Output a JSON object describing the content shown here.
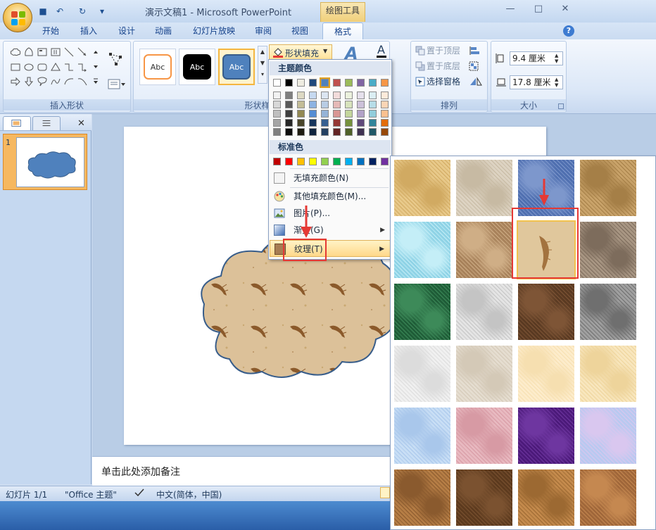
{
  "window": {
    "title": "演示文稿1 - Microsoft PowerPoint",
    "context_tab_title": "绘图工具",
    "minimize": "—",
    "restore": "□",
    "close": "✕"
  },
  "qat": {
    "save": "■",
    "undo": "↶",
    "redo": "↻",
    "customize": "▾"
  },
  "tabs": [
    {
      "label": "开始"
    },
    {
      "label": "插入"
    },
    {
      "label": "设计"
    },
    {
      "label": "动画"
    },
    {
      "label": "幻灯片放映"
    },
    {
      "label": "审阅"
    },
    {
      "label": "视图"
    },
    {
      "label": "格式"
    }
  ],
  "help": "?",
  "ribbon": {
    "groups": {
      "insert_shapes": "插入形状",
      "shape_styles": "形状样式",
      "arrange": "排列",
      "size": "大小"
    },
    "style_sample": "Abc",
    "shape_fill_button": "形状填充",
    "bring_to_front": "置于顶层",
    "send_to_back": "置于底层",
    "selection_pane": "选择窗格",
    "height_value": "9.4 厘米",
    "width_value": "17.8 厘米"
  },
  "fill_menu": {
    "theme_colors_header": "主题颜色",
    "standard_colors_header": "标准色",
    "no_fill": "无填充颜色(N)",
    "more_colors": "其他填充颜色(M)...",
    "picture": "图片(P)...",
    "gradient": "渐变(G)",
    "texture": "纹理(T)",
    "theme_top": [
      "#ffffff",
      "#000000",
      "#eeece1",
      "#1f497d",
      "#4f81bd",
      "#c0504d",
      "#9bbb59",
      "#8064a2",
      "#4bacc6",
      "#f79646"
    ],
    "theme_shades": [
      [
        "#f2f2f2",
        "#7f7f7f",
        "#ddd9c3",
        "#c6d9f0",
        "#dbe5f1",
        "#f2dcdb",
        "#ebf1dd",
        "#e5e0ec",
        "#dbeef3",
        "#fdeada"
      ],
      [
        "#d8d8d8",
        "#595959",
        "#c4bd97",
        "#8db3e2",
        "#b8cce4",
        "#e5b9b7",
        "#d7e3bc",
        "#ccc1d9",
        "#b7dde8",
        "#fbd5b5"
      ],
      [
        "#bfbfbf",
        "#3f3f3f",
        "#938953",
        "#548dd4",
        "#95b3d7",
        "#d99694",
        "#c3d69b",
        "#b2a2c7",
        "#92cddc",
        "#fac08f"
      ],
      [
        "#a5a5a5",
        "#262626",
        "#494429",
        "#17365d",
        "#366092",
        "#953734",
        "#76923c",
        "#5f497a",
        "#31859b",
        "#e36c09"
      ],
      [
        "#7f7f7f",
        "#0c0c0c",
        "#1d1b10",
        "#0f243e",
        "#244061",
        "#632423",
        "#4f6128",
        "#3f3151",
        "#205867",
        "#974806"
      ]
    ],
    "standard": [
      "#c00000",
      "#ff0000",
      "#ffc000",
      "#ffff00",
      "#92d050",
      "#00b050",
      "#00b0f0",
      "#0070c0",
      "#002060",
      "#7030a0"
    ]
  },
  "textures": [
    {
      "name": "papyrus",
      "base": "#e8c98a",
      "accent": "#d1aa62"
    },
    {
      "name": "canvas",
      "base": "#ddd3c2",
      "accent": "#c7baa3"
    },
    {
      "name": "denim",
      "base": "#4f6fb0",
      "accent": "#7d97cc"
    },
    {
      "name": "woven-mat",
      "base": "#c9a36a",
      "accent": "#a57f47"
    },
    {
      "name": "water-droplets",
      "base": "#8fd3e6",
      "accent": "#c4eef7"
    },
    {
      "name": "paper-bag",
      "base": "#a8825b",
      "accent": "#cfae86"
    },
    {
      "name": "fish-fossil",
      "base": "#e0c79c",
      "accent": "#a3733f"
    },
    {
      "name": "sand",
      "base": "#a89683",
      "accent": "#7d6c5c"
    },
    {
      "name": "green-marble",
      "base": "#1f5d38",
      "accent": "#3d8a59"
    },
    {
      "name": "white-marble",
      "base": "#e4e4e4",
      "accent": "#c4c4c4"
    },
    {
      "name": "brown-marble",
      "base": "#5a3a22",
      "accent": "#7e5536"
    },
    {
      "name": "granite",
      "base": "#a0a0a0",
      "accent": "#6f6f6f"
    },
    {
      "name": "newsprint",
      "base": "#f0f0f0",
      "accent": "#dcdcdc"
    },
    {
      "name": "recycled-paper",
      "base": "#e5ddd0",
      "accent": "#d4c9b7"
    },
    {
      "name": "parchment",
      "base": "#fdeccb",
      "accent": "#f6dfb0"
    },
    {
      "name": "stationery",
      "base": "#f8e6bd",
      "accent": "#eed49b"
    },
    {
      "name": "blue-tissue",
      "base": "#c8def5",
      "accent": "#a9c7eb"
    },
    {
      "name": "pink-tissue",
      "base": "#e8b9c0",
      "accent": "#d79aa4"
    },
    {
      "name": "purple-mesh",
      "base": "#4c1a7a",
      "accent": "#6e36a0"
    },
    {
      "name": "bouquet",
      "base": "#b9c9f0",
      "accent": "#d9c7ef"
    },
    {
      "name": "cork",
      "base": "#b57d45",
      "accent": "#8a5a2e"
    },
    {
      "name": "walnut",
      "base": "#5c3a1e",
      "accent": "#7b5230"
    },
    {
      "name": "oak",
      "base": "#c48a4c",
      "accent": "#9c6932"
    },
    {
      "name": "medium-wood",
      "base": "#a0673a",
      "accent": "#c58850"
    }
  ],
  "left_pane": {
    "slide_number": "1",
    "close": "✕"
  },
  "notes": {
    "placeholder": "单击此处添加备注"
  },
  "status": {
    "slide_info": "幻灯片 1/1",
    "theme": "\"Office 主题\"",
    "language": "中文(简体，中国)"
  },
  "colors": {
    "accent": "#4f81bd",
    "highlight": "#e53935",
    "shape_fill": "#dcc199"
  }
}
